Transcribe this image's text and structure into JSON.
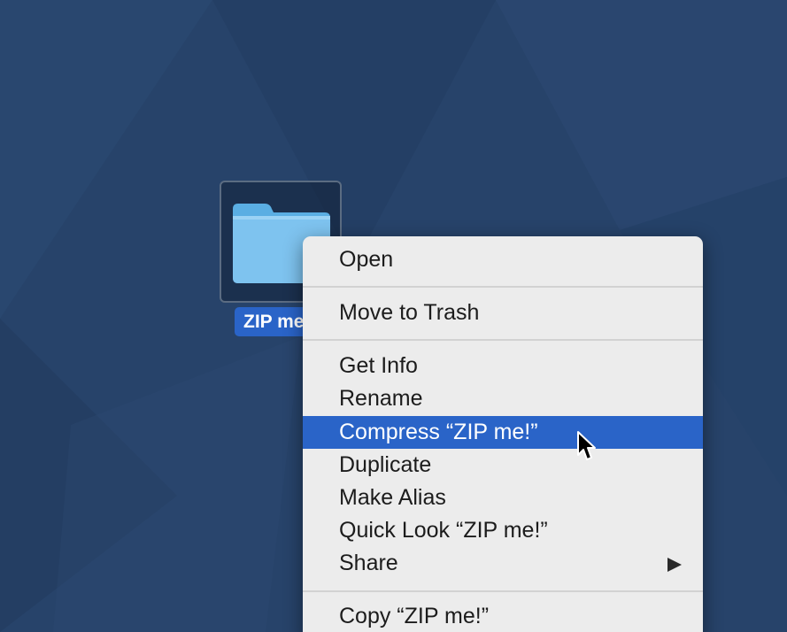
{
  "desktop": {
    "folder": {
      "icon": "folder-icon",
      "label": "ZIP me!"
    }
  },
  "context_menu": {
    "items": [
      {
        "label": "Open"
      },
      {
        "label": "Move to Trash"
      },
      {
        "label": "Get Info"
      },
      {
        "label": "Rename"
      },
      {
        "label": "Compress “ZIP me!”",
        "highlighted": true
      },
      {
        "label": "Duplicate"
      },
      {
        "label": "Make Alias"
      },
      {
        "label": "Quick Look “ZIP me!”"
      },
      {
        "label": "Share",
        "submenu": true,
        "submenu_icon": "chevron-right-icon"
      },
      {
        "label": "Copy “ZIP me!”"
      }
    ]
  },
  "cursor": {
    "icon": "arrow-cursor-icon"
  },
  "colors": {
    "desktop_background": "#27436a",
    "menu_background": "#ececec",
    "highlight": "#2a64c8",
    "folder_blue": "#7ec3ef"
  }
}
